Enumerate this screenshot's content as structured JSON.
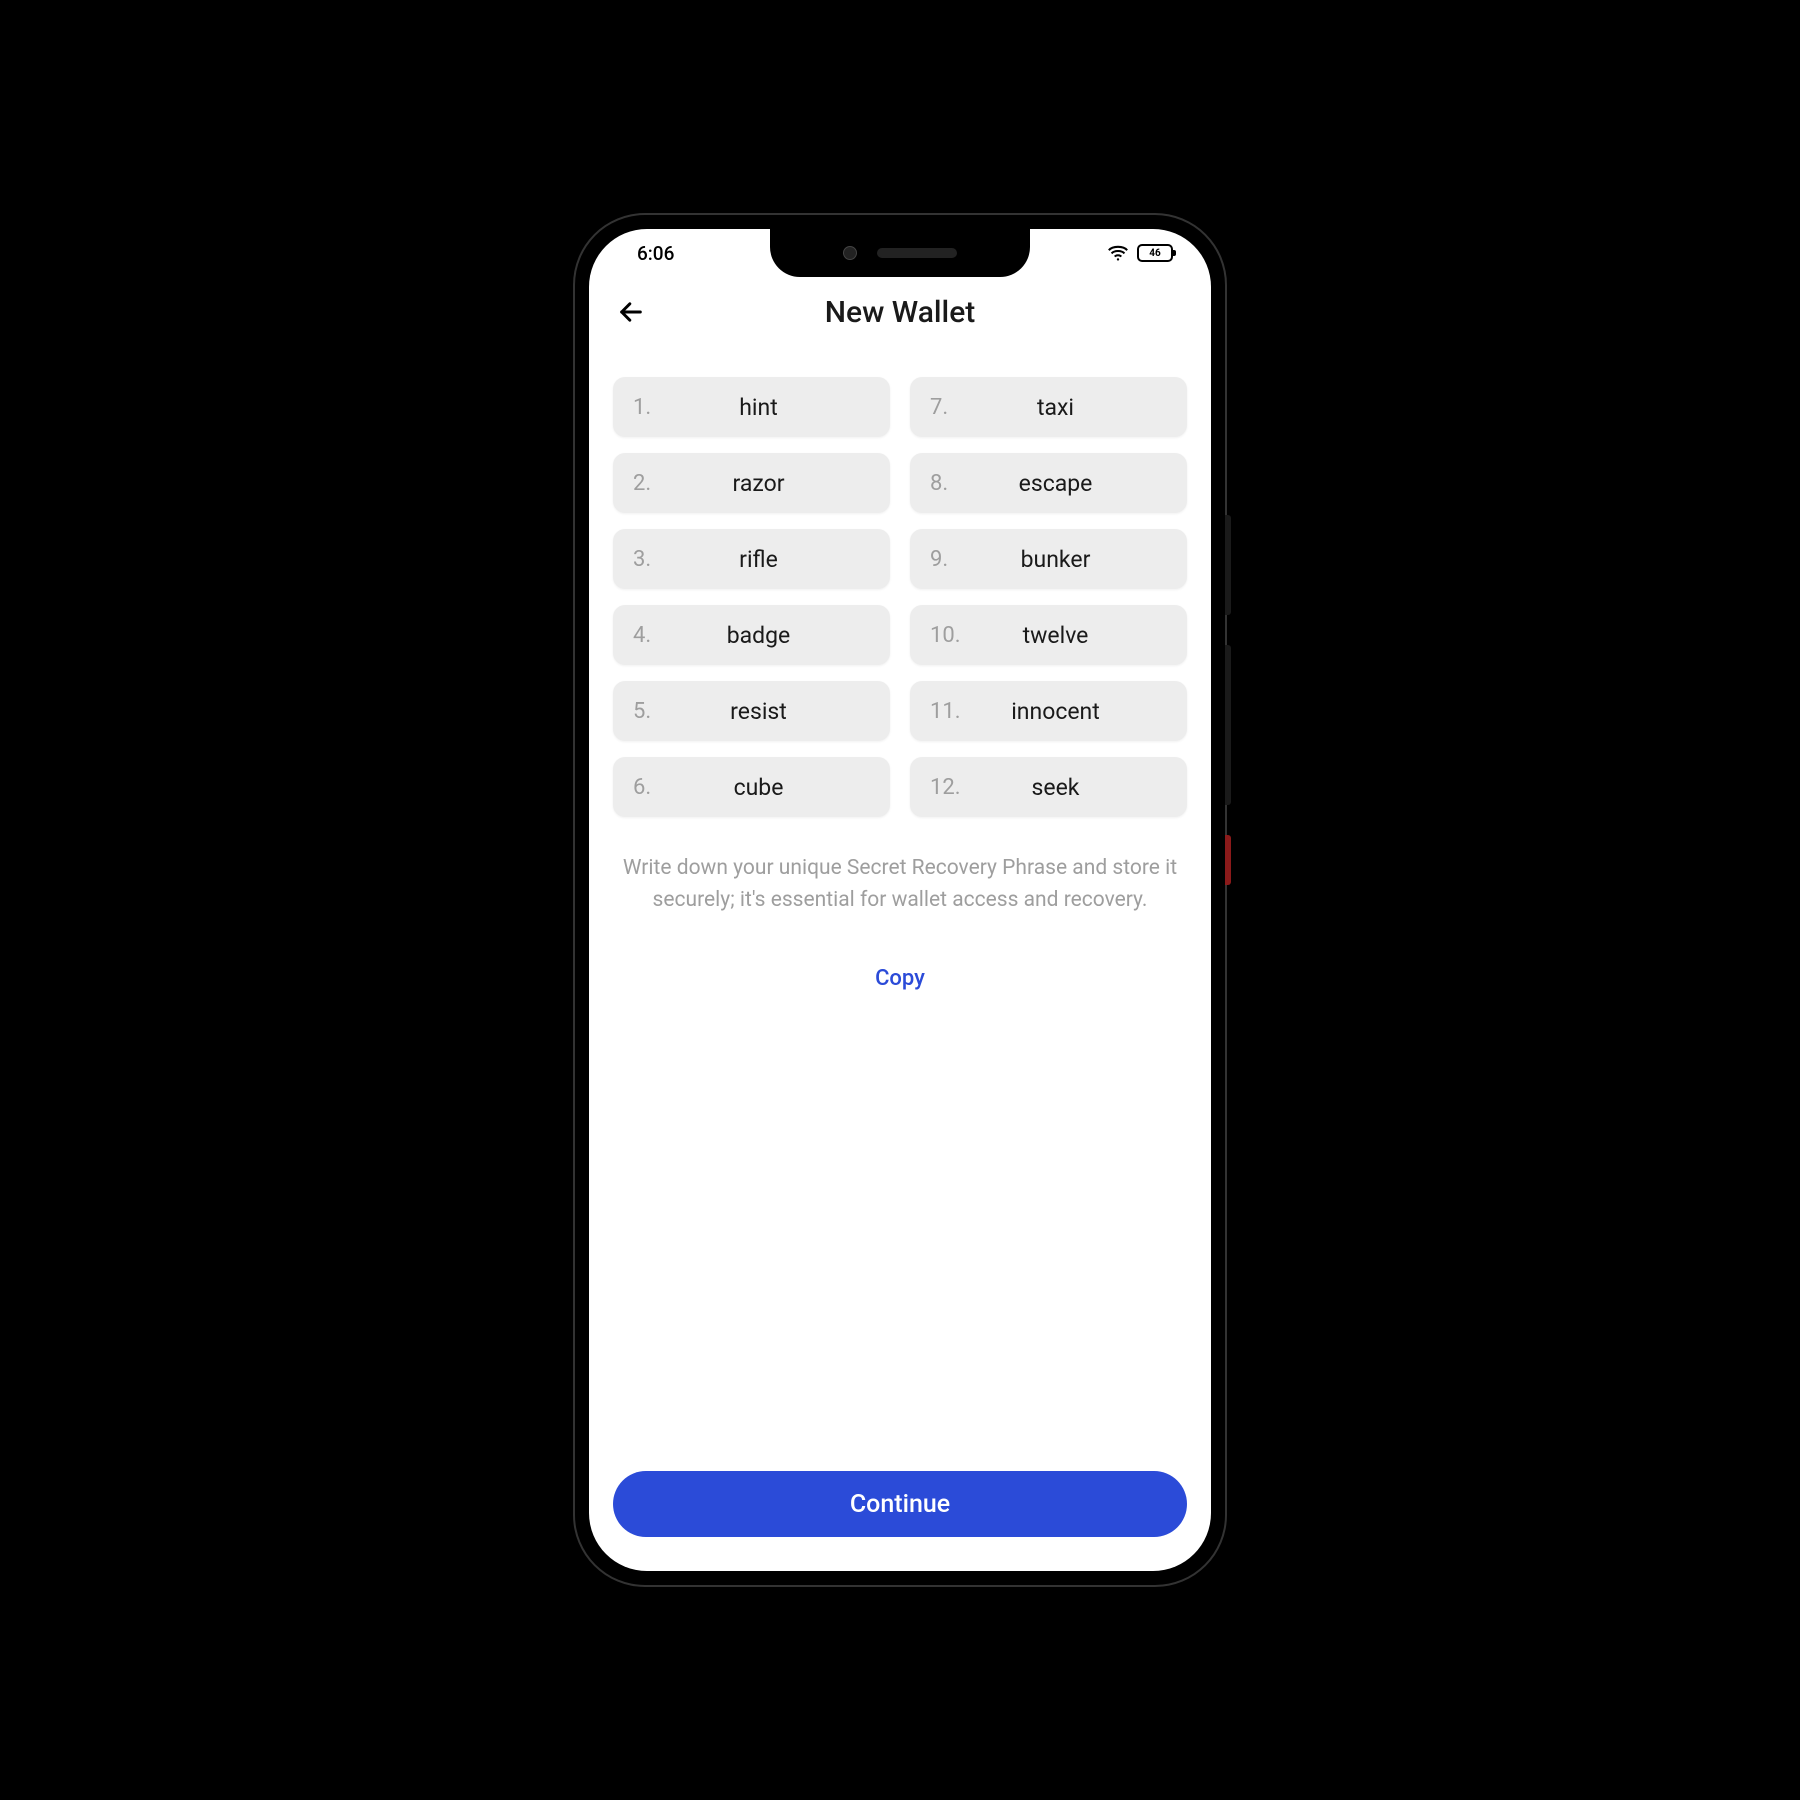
{
  "status": {
    "time": "6:06",
    "battery": "46"
  },
  "header": {
    "title": "New Wallet"
  },
  "phrase": {
    "words": [
      {
        "n": "1.",
        "w": "hint"
      },
      {
        "n": "2.",
        "w": "razor"
      },
      {
        "n": "3.",
        "w": "rifle"
      },
      {
        "n": "4.",
        "w": "badge"
      },
      {
        "n": "5.",
        "w": "resist"
      },
      {
        "n": "6.",
        "w": "cube"
      },
      {
        "n": "7.",
        "w": "taxi"
      },
      {
        "n": "8.",
        "w": "escape"
      },
      {
        "n": "9.",
        "w": "bunker"
      },
      {
        "n": "10.",
        "w": "twelve"
      },
      {
        "n": "11.",
        "w": "innocent"
      },
      {
        "n": "12.",
        "w": "seek"
      }
    ]
  },
  "instructions": "Write down your unique Secret Recovery Phrase and store it securely; it's essential for wallet access and recovery.",
  "actions": {
    "copy": "Copy",
    "continue": "Continue"
  }
}
